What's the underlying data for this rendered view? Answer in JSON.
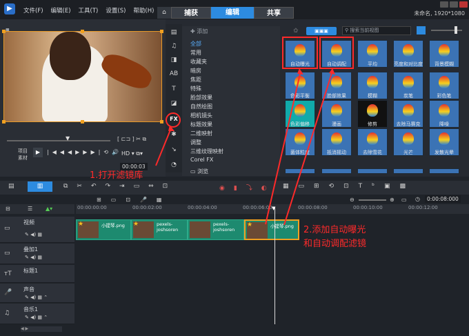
{
  "menu": [
    "文件(F)",
    "编辑(E)",
    "工具(T)",
    "设置(S)",
    "帮助(H)"
  ],
  "tabs": {
    "capture": "捕获",
    "edit": "编辑",
    "share": "共享"
  },
  "project": "未命名, 1920*1080",
  "player": {
    "timecode": "00:00:03",
    "project_label": "项目",
    "clip_label": "素材"
  },
  "library": {
    "add_label": "添加",
    "search_placeholder": "搜索当前视图",
    "browse_label": "浏览"
  },
  "categories": [
    "全部",
    "常用",
    "收藏夹",
    "暗房",
    "焦距",
    "特殊",
    "脸部效果",
    "自然绘图",
    "相机镜头",
    "标题效果",
    "二维映射",
    "调整",
    "三维纹理映射",
    "Corel FX"
  ],
  "filters": [
    {
      "label": "自动曝光"
    },
    {
      "label": "自动调配"
    },
    {
      "label": "平均"
    },
    {
      "label": "亮度和对比度"
    },
    {
      "label": "背景模糊"
    },
    {
      "label": "色彩平衡"
    },
    {
      "label": "脸部效果"
    },
    {
      "label": "模糊"
    },
    {
      "label": "炭笔"
    },
    {
      "label": "彩色笔"
    },
    {
      "label": "色彩偏移"
    },
    {
      "label": "漫画"
    },
    {
      "label": "修剪"
    },
    {
      "label": "去除马赛克"
    },
    {
      "label": "降噪"
    },
    {
      "label": "菌体粒度"
    },
    {
      "label": "抵消摇动"
    },
    {
      "label": "去除雪花"
    },
    {
      "label": "光芒"
    },
    {
      "label": "发散光晕"
    }
  ],
  "timeline": {
    "zoom_time": "0:00:08:000",
    "ruler": [
      "00:00:00:00",
      "00:00:02:00",
      "00:00:04:00",
      "00:00:06:00",
      "00:00:08:00",
      "00:00:10:00",
      "00:00:12:00"
    ],
    "tracks": [
      "视频",
      "叠加1",
      "标题1",
      "声音",
      "音乐1"
    ],
    "clips": [
      "小提琴.png",
      "pexels-joshsoren",
      "pexels-joshsoren",
      "小提琴.png"
    ]
  },
  "annotations": {
    "step1": "1.打开滤镜库",
    "step2_line1": "2.添加自动曝光",
    "step2_line2": "和自动调配滤镜"
  }
}
